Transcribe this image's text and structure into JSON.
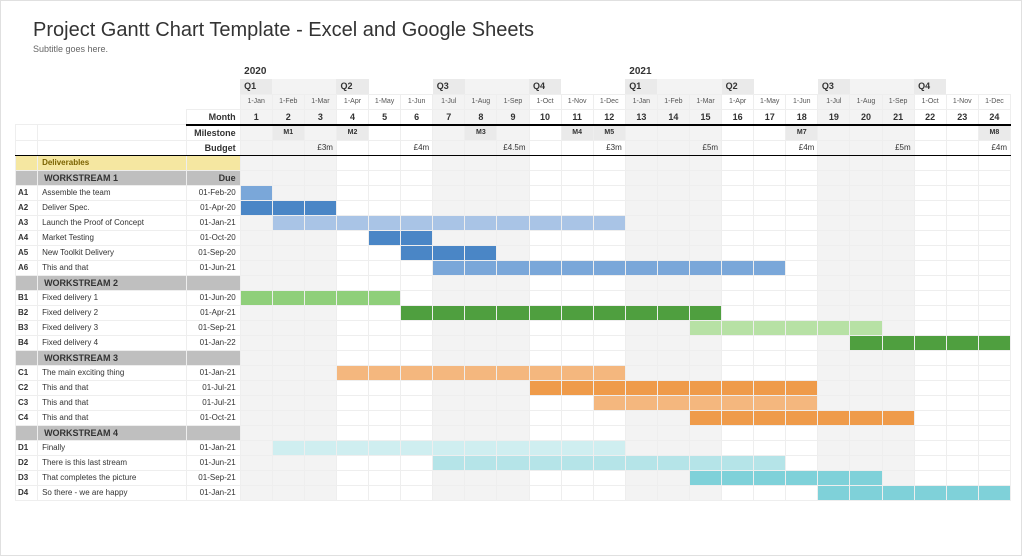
{
  "title": "Project Gantt Chart Template - Excel and Google Sheets",
  "subtitle": "Subtitle goes here.",
  "header_labels": {
    "month": "Month",
    "milestone": "Milestone",
    "budget": "Budget",
    "deliverables": "Deliverables",
    "due": "Due"
  },
  "years": [
    {
      "label": "2020",
      "start": 1,
      "span": 12
    },
    {
      "label": "2021",
      "start": 13,
      "span": 12
    }
  ],
  "quarters": [
    {
      "label": "Q1",
      "start": 1
    },
    {
      "label": "Q2",
      "start": 4
    },
    {
      "label": "Q3",
      "start": 7
    },
    {
      "label": "Q4",
      "start": 10
    },
    {
      "label": "Q1",
      "start": 13
    },
    {
      "label": "Q2",
      "start": 16
    },
    {
      "label": "Q3",
      "start": 19
    },
    {
      "label": "Q4",
      "start": 22
    }
  ],
  "months": [
    {
      "n": 1,
      "date": "1-Jan"
    },
    {
      "n": 2,
      "date": "1-Feb"
    },
    {
      "n": 3,
      "date": "1-Mar"
    },
    {
      "n": 4,
      "date": "1-Apr"
    },
    {
      "n": 5,
      "date": "1-May"
    },
    {
      "n": 6,
      "date": "1-Jun"
    },
    {
      "n": 7,
      "date": "1-Jul"
    },
    {
      "n": 8,
      "date": "1-Aug"
    },
    {
      "n": 9,
      "date": "1-Sep"
    },
    {
      "n": 10,
      "date": "1-Oct"
    },
    {
      "n": 11,
      "date": "1-Nov"
    },
    {
      "n": 12,
      "date": "1-Dec"
    },
    {
      "n": 13,
      "date": "1-Jan"
    },
    {
      "n": 14,
      "date": "1-Feb"
    },
    {
      "n": 15,
      "date": "1-Mar"
    },
    {
      "n": 16,
      "date": "1-Apr"
    },
    {
      "n": 17,
      "date": "1-May"
    },
    {
      "n": 18,
      "date": "1-Jun"
    },
    {
      "n": 19,
      "date": "1-Jul"
    },
    {
      "n": 20,
      "date": "1-Aug"
    },
    {
      "n": 21,
      "date": "1-Sep"
    },
    {
      "n": 22,
      "date": "1-Oct"
    },
    {
      "n": 23,
      "date": "1-Nov"
    },
    {
      "n": 24,
      "date": "1-Dec"
    }
  ],
  "milestones": {
    "2": "M1",
    "4": "M2",
    "8": "M3",
    "11": "M4",
    "12": "M5",
    "18": "M7",
    "24": "M8"
  },
  "budgets": {
    "3": "£3m",
    "6": "£4m",
    "9": "£4.5m",
    "12": "£3m",
    "15": "£5m",
    "18": "£4m",
    "21": "£5m",
    "24": "£4m"
  },
  "workstreams": [
    {
      "name": "WORKSTREAM 1",
      "tasks": [
        {
          "id": "A1",
          "label": "Assemble the team",
          "due": "01-Feb-20",
          "start": 1,
          "end": 1,
          "color": "blue1"
        },
        {
          "id": "A2",
          "label": "Deliver Spec.",
          "due": "01-Apr-20",
          "start": 1,
          "end": 3,
          "color": "blue2"
        },
        {
          "id": "A3",
          "label": "Launch the Proof of Concept",
          "due": "01-Jan-21",
          "start": 2,
          "end": 12,
          "color": "blue3"
        },
        {
          "id": "A4",
          "label": "Market Testing",
          "due": "01-Oct-20",
          "start": 5,
          "end": 6,
          "color": "blue2"
        },
        {
          "id": "A5",
          "label": "New Toolkit Delivery",
          "due": "01-Sep-20",
          "start": 6,
          "end": 8,
          "color": "blue2"
        },
        {
          "id": "A6",
          "label": "This and that",
          "due": "01-Jun-21",
          "start": 7,
          "end": 17,
          "color": "blue1"
        }
      ]
    },
    {
      "name": "WORKSTREAM 2",
      "tasks": [
        {
          "id": "B1",
          "label": "Fixed delivery 1",
          "due": "01-Jun-20",
          "start": 1,
          "end": 5,
          "color": "green1"
        },
        {
          "id": "B2",
          "label": "Fixed delivery 2",
          "due": "01-Apr-21",
          "start": 6,
          "end": 15,
          "color": "green2"
        },
        {
          "id": "B3",
          "label": "Fixed delivery 3",
          "due": "01-Sep-21",
          "start": 15,
          "end": 20,
          "color": "green3"
        },
        {
          "id": "B4",
          "label": "Fixed delivery 4",
          "due": "01-Jan-22",
          "start": 20,
          "end": 24,
          "color": "green2"
        }
      ]
    },
    {
      "name": "WORKSTREAM 3",
      "tasks": [
        {
          "id": "C1",
          "label": "The main exciting thing",
          "due": "01-Jan-21",
          "start": 4,
          "end": 12,
          "color": "orange1"
        },
        {
          "id": "C2",
          "label": "This and that",
          "due": "01-Jul-21",
          "start": 10,
          "end": 18,
          "color": "orange2"
        },
        {
          "id": "C3",
          "label": "This and that",
          "due": "01-Jul-21",
          "start": 12,
          "end": 18,
          "color": "orange1"
        },
        {
          "id": "C4",
          "label": "This and that",
          "due": "01-Oct-21",
          "start": 15,
          "end": 21,
          "color": "orange2"
        }
      ]
    },
    {
      "name": "WORKSTREAM 4",
      "tasks": [
        {
          "id": "D1",
          "label": "Finally",
          "due": "01-Jan-21",
          "start": 2,
          "end": 12,
          "color": "teal3"
        },
        {
          "id": "D2",
          "label": "There is this last stream",
          "due": "01-Jun-21",
          "start": 7,
          "end": 17,
          "color": "teal1"
        },
        {
          "id": "D3",
          "label": "That completes the picture",
          "due": "01-Sep-21",
          "start": 15,
          "end": 20,
          "color": "teal2"
        },
        {
          "id": "D4",
          "label": "So there - we are happy",
          "due": "01-Jan-21",
          "start": 19,
          "end": 24,
          "color": "teal2"
        }
      ]
    }
  ],
  "chart_data": {
    "type": "gantt",
    "title": "Project Gantt Chart Template - Excel and Google Sheets",
    "x_unit": "month",
    "x": [
      1,
      2,
      3,
      4,
      5,
      6,
      7,
      8,
      9,
      10,
      11,
      12,
      13,
      14,
      15,
      16,
      17,
      18,
      19,
      20,
      21,
      22,
      23,
      24
    ],
    "x_labels": [
      "Jan-20",
      "Feb-20",
      "Mar-20",
      "Apr-20",
      "May-20",
      "Jun-20",
      "Jul-20",
      "Aug-20",
      "Sep-20",
      "Oct-20",
      "Nov-20",
      "Dec-20",
      "Jan-21",
      "Feb-21",
      "Mar-21",
      "Apr-21",
      "May-21",
      "Jun-21",
      "Jul-21",
      "Aug-21",
      "Sep-21",
      "Oct-21",
      "Nov-21",
      "Dec-21"
    ],
    "series": [
      {
        "group": "WORKSTREAM 1",
        "id": "A1",
        "name": "Assemble the team",
        "start": 1,
        "end": 1
      },
      {
        "group": "WORKSTREAM 1",
        "id": "A2",
        "name": "Deliver Spec.",
        "start": 1,
        "end": 3
      },
      {
        "group": "WORKSTREAM 1",
        "id": "A3",
        "name": "Launch the Proof of Concept",
        "start": 2,
        "end": 12
      },
      {
        "group": "WORKSTREAM 1",
        "id": "A4",
        "name": "Market Testing",
        "start": 5,
        "end": 6
      },
      {
        "group": "WORKSTREAM 1",
        "id": "A5",
        "name": "New Toolkit Delivery",
        "start": 6,
        "end": 8
      },
      {
        "group": "WORKSTREAM 1",
        "id": "A6",
        "name": "This and that",
        "start": 7,
        "end": 17
      },
      {
        "group": "WORKSTREAM 2",
        "id": "B1",
        "name": "Fixed delivery 1",
        "start": 1,
        "end": 5
      },
      {
        "group": "WORKSTREAM 2",
        "id": "B2",
        "name": "Fixed delivery 2",
        "start": 6,
        "end": 15
      },
      {
        "group": "WORKSTREAM 2",
        "id": "B3",
        "name": "Fixed delivery 3",
        "start": 15,
        "end": 20
      },
      {
        "group": "WORKSTREAM 2",
        "id": "B4",
        "name": "Fixed delivery 4",
        "start": 20,
        "end": 24
      },
      {
        "group": "WORKSTREAM 3",
        "id": "C1",
        "name": "The main exciting thing",
        "start": 4,
        "end": 12
      },
      {
        "group": "WORKSTREAM 3",
        "id": "C2",
        "name": "This and that",
        "start": 10,
        "end": 18
      },
      {
        "group": "WORKSTREAM 3",
        "id": "C3",
        "name": "This and that",
        "start": 12,
        "end": 18
      },
      {
        "group": "WORKSTREAM 3",
        "id": "C4",
        "name": "This and that",
        "start": 15,
        "end": 21
      },
      {
        "group": "WORKSTREAM 4",
        "id": "D1",
        "name": "Finally",
        "start": 2,
        "end": 12
      },
      {
        "group": "WORKSTREAM 4",
        "id": "D2",
        "name": "There is this last stream",
        "start": 7,
        "end": 17
      },
      {
        "group": "WORKSTREAM 4",
        "id": "D3",
        "name": "That completes the picture",
        "start": 15,
        "end": 20
      },
      {
        "group": "WORKSTREAM 4",
        "id": "D4",
        "name": "So there - we are happy",
        "start": 19,
        "end": 24
      }
    ],
    "milestones": [
      {
        "month": 2,
        "label": "M1"
      },
      {
        "month": 4,
        "label": "M2"
      },
      {
        "month": 8,
        "label": "M3"
      },
      {
        "month": 11,
        "label": "M4"
      },
      {
        "month": 12,
        "label": "M5"
      },
      {
        "month": 18,
        "label": "M7"
      },
      {
        "month": 24,
        "label": "M8"
      }
    ],
    "budget_by_quarter_end": [
      {
        "month": 3,
        "value": "£3m"
      },
      {
        "month": 6,
        "value": "£4m"
      },
      {
        "month": 9,
        "value": "£4.5m"
      },
      {
        "month": 12,
        "value": "£3m"
      },
      {
        "month": 15,
        "value": "£5m"
      },
      {
        "month": 18,
        "value": "£4m"
      },
      {
        "month": 21,
        "value": "£5m"
      },
      {
        "month": 24,
        "value": "£4m"
      }
    ]
  }
}
